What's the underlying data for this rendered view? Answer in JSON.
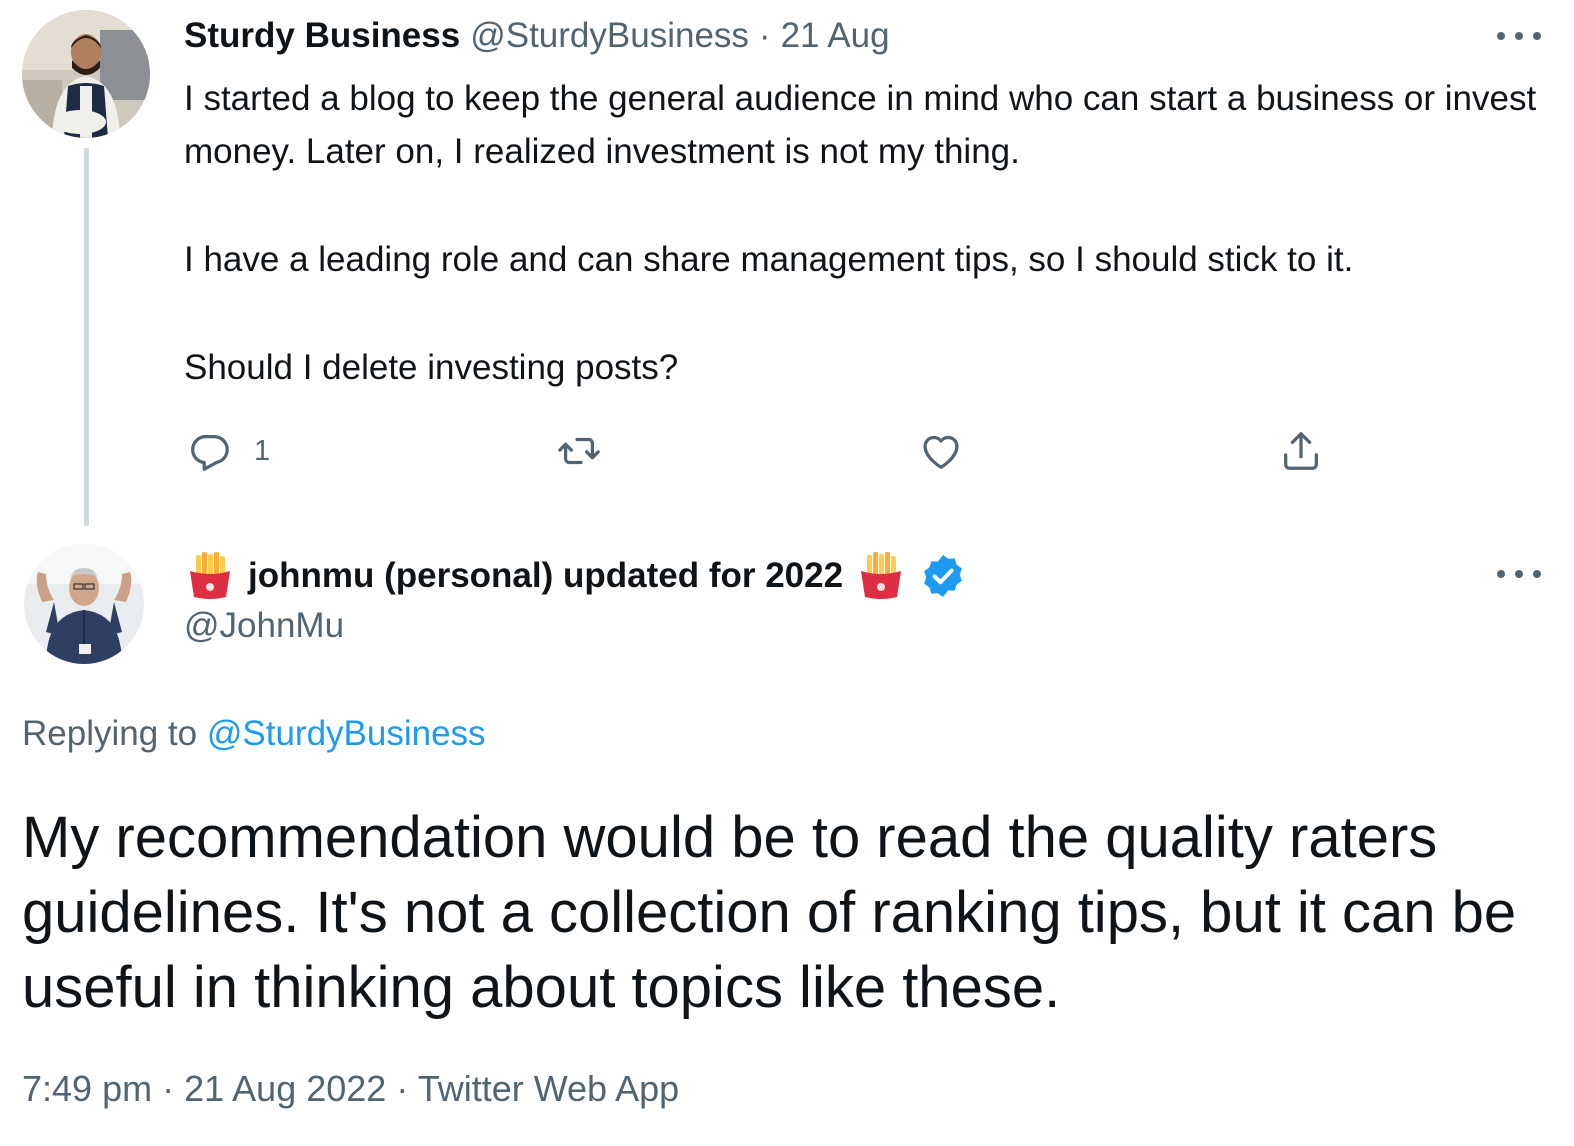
{
  "parent_tweet": {
    "display_name": "Sturdy Business",
    "handle": "@SturdyBusiness",
    "separator": "·",
    "date": "21 Aug",
    "paragraphs": [
      "I started a blog to keep the general audience in mind who can start a business or invest money. Later on, I realized investment is not my thing.",
      "I have a leading role and can share management tips, so I should stick to it.",
      "Should I delete investing posts?"
    ],
    "actions": {
      "reply_count": "1",
      "retweet_count": "",
      "like_count": "",
      "share_icon": "share-icon"
    }
  },
  "reply_tweet": {
    "display_name": "johnmu (personal) updated for 2022",
    "name_emoji": "french-fries",
    "verified": true,
    "handle": "@JohnMu",
    "replying_prefix": "Replying to",
    "replying_handle": "@SturdyBusiness",
    "text": "My recommendation would be to read the quality raters guidelines. It's not a collection of ranking tips, but it can be useful in thinking about topics like these.",
    "time": "7:49 pm",
    "date": "21 Aug 2022",
    "source": "Twitter Web App",
    "separator": "·"
  },
  "colors": {
    "text_primary": "#0f1419",
    "text_secondary": "#536471",
    "link_blue": "#1d9bf0",
    "thread_line": "#cfd9de",
    "verified_blue": "#1d9bf0"
  }
}
